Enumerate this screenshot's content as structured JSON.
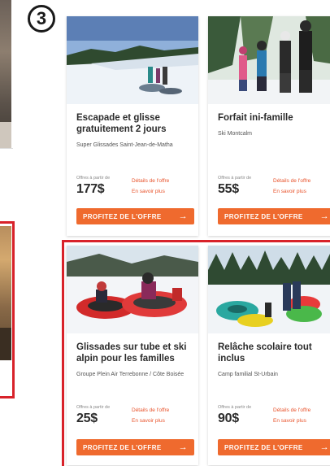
{
  "step_badge": "3",
  "cards": [
    {
      "title": "Escapade et glisse gratuitement 2 jours",
      "subtitle": "Super Glissades Saint-Jean-de-Matha",
      "offer_label": "Offres à partir de",
      "price": "177$",
      "details_link": "Détails de l'offre",
      "more_link": "En savoir plus",
      "cta_label": "PROFITEZ DE L'OFFRE",
      "cta_icon": "arrow-right-icon"
    },
    {
      "title": "Forfait ini-famille",
      "subtitle": "Ski Montcalm",
      "offer_label": "Offres à partir de",
      "price": "55$",
      "details_link": "Détails de l'offre",
      "more_link": "En savoir plus",
      "cta_label": "PROFITEZ DE L'OFFRE",
      "cta_icon": "arrow-right-icon"
    },
    {
      "title": "Glissades sur tube et ski alpin pour les familles",
      "subtitle": "Groupe Plein Air Terrebonne / Côte Boisée",
      "offer_label": "Offres à partir de",
      "price": "25$",
      "details_link": "Détails de l'offre",
      "more_link": "En savoir plus",
      "cta_label": "PROFITEZ DE L'OFFRE",
      "cta_icon": "arrow-right-icon"
    },
    {
      "title": "Relâche scolaire tout inclus",
      "subtitle": "Camp familial St-Urbain",
      "offer_label": "Offres à partir de",
      "price": "90$",
      "details_link": "Détails de l'offre",
      "more_link": "En savoir plus",
      "cta_label": "PROFITEZ DE L'OFFRE",
      "cta_icon": "arrow-right-icon"
    }
  ],
  "colors": {
    "accent": "#ef6a2e",
    "link": "#e8522a",
    "highlight": "#d8222a"
  }
}
